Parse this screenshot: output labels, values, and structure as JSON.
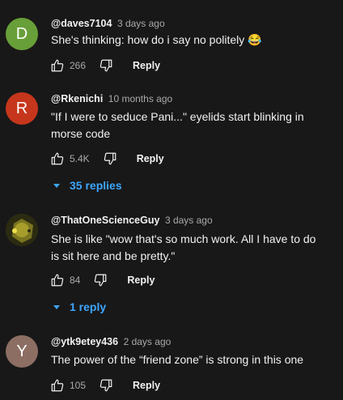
{
  "comments": [
    {
      "avatar_letter": "D",
      "avatar_color": "#689f38",
      "author": "@daves7104",
      "time": "3 days ago",
      "text": "She's thinking: how do i say no politely 😂",
      "likes": "266",
      "reply_label": "Reply"
    },
    {
      "avatar_letter": "R",
      "avatar_color": "#c6361c",
      "author": "@Rkenichi",
      "time": "10 months ago",
      "text": "\"If I were to seduce Pani...\" eyelids start blinking in morse code",
      "likes": "5.4K",
      "reply_label": "Reply",
      "replies_label": "35 replies"
    },
    {
      "avatar_letter": "",
      "avatar_color": "#3a3a1a",
      "author": "@ThatOneScienceGuy",
      "time": "3 days ago",
      "text": "She is like \"wow that's so much work. All I have to do is sit here and be pretty.\"",
      "likes": "84",
      "reply_label": "Reply",
      "replies_label": "1 reply"
    },
    {
      "avatar_letter": "Y",
      "avatar_color": "#8d6e63",
      "author": "@ytk9etey436",
      "time": "2 days ago",
      "text": "The power of the “friend zone” is strong in this one",
      "likes": "105",
      "reply_label": "Reply"
    }
  ],
  "icons": {
    "like": "thumbs-up-icon",
    "dislike": "thumbs-down-icon",
    "expand": "chevron-down-icon"
  }
}
